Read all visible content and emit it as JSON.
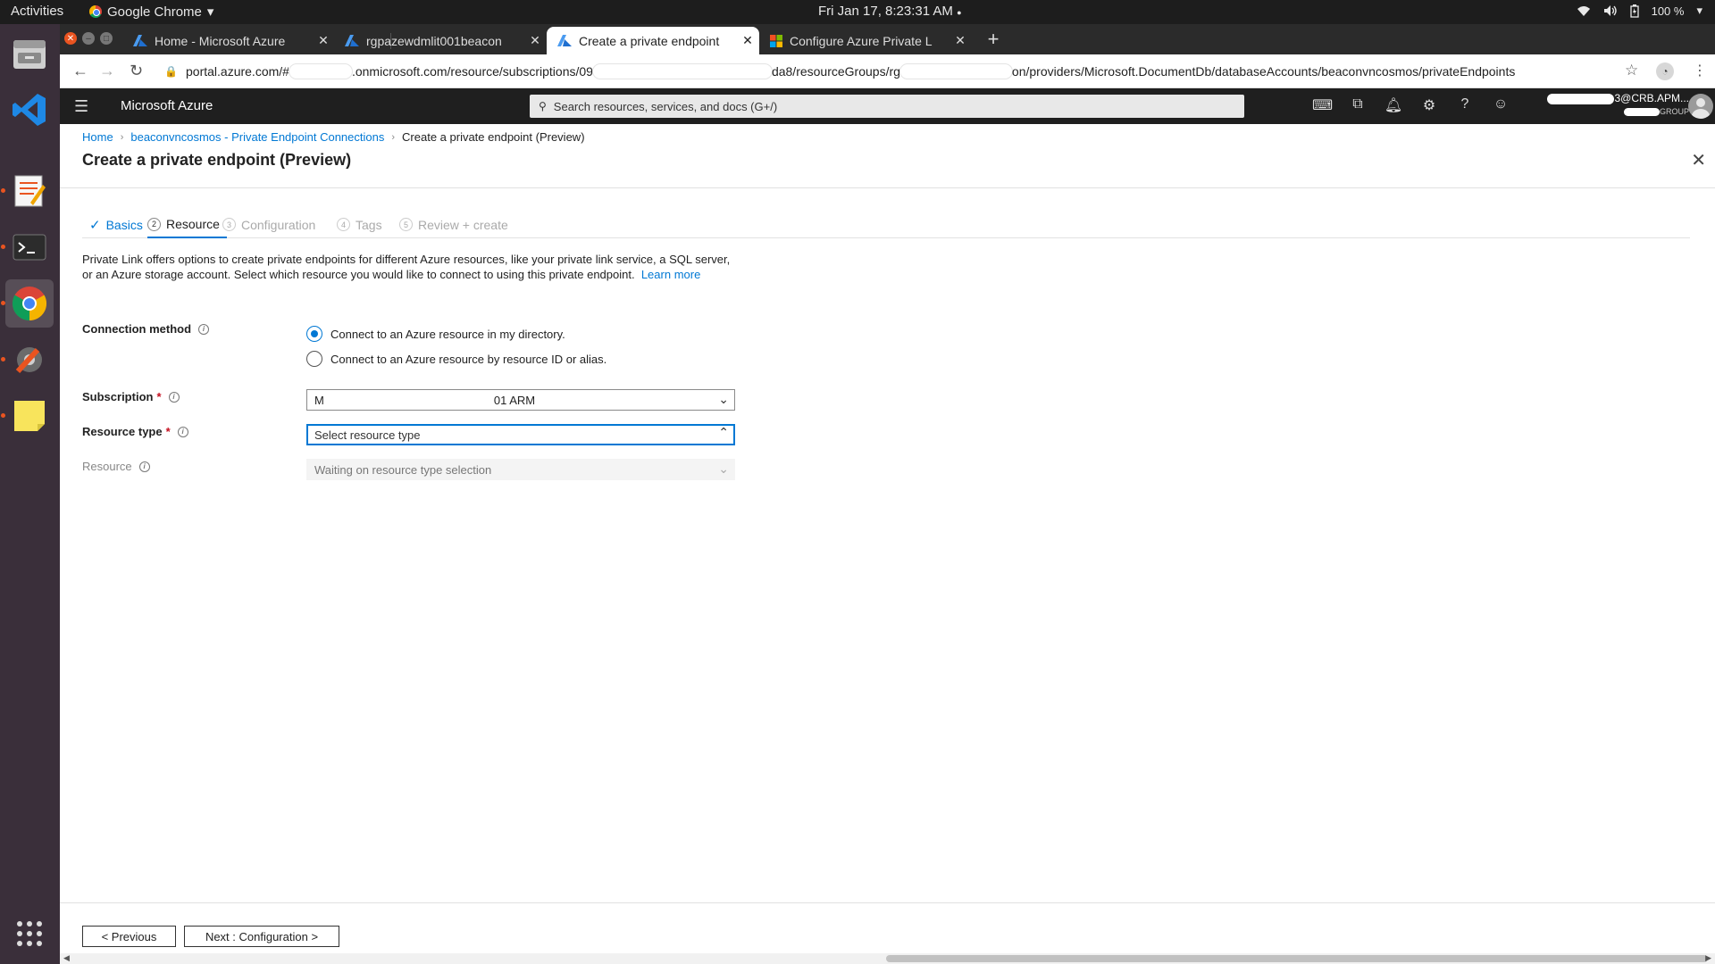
{
  "os": {
    "activities": "Activities",
    "app_name": "Google Chrome",
    "app_menu_caret": "▾",
    "clock": "Fri Jan 17,  8:23:31 AM",
    "clock_dot": "●",
    "battery": "100 %"
  },
  "browser": {
    "tabs": [
      {
        "title": "Home - Microsoft Azure",
        "icon": "azure-icon",
        "active": false
      },
      {
        "title": "rgpazewdmlit001beacon",
        "icon": "azure-icon",
        "active": false
      },
      {
        "title": "Create a private endpoint",
        "icon": "azure-icon",
        "active": true
      },
      {
        "title": "Configure Azure Private L",
        "icon": "microsoft-icon",
        "active": false
      }
    ],
    "url_parts": [
      "portal.azure.com/#",
      ".onmicrosoft.com/resource/subscriptions/09",
      "da8/resourceGroups/rg",
      "on/providers/Microsoft.DocumentDb/databaseAccounts/beaconvncosmos/privateEndpoints"
    ]
  },
  "azure": {
    "brand": "Microsoft Azure",
    "search_placeholder": "Search resources, services, and docs (G+/)",
    "account_name": "3@CRB.APM...",
    "account_dir": "GROUP",
    "breadcrumb": [
      {
        "label": "Home",
        "link": true
      },
      {
        "label": "beaconvncosmos - Private Endpoint Connections",
        "link": true
      },
      {
        "label": "Create a private endpoint (Preview)",
        "link": false
      }
    ],
    "page_title": "Create a private endpoint (Preview)",
    "steps": [
      {
        "num": "✓",
        "label": "Basics",
        "state": "done"
      },
      {
        "num": "2",
        "label": "Resource",
        "state": "current"
      },
      {
        "num": "3",
        "label": "Configuration",
        "state": "future"
      },
      {
        "num": "4",
        "label": "Tags",
        "state": "future"
      },
      {
        "num": "5",
        "label": "Review + create",
        "state": "future"
      }
    ],
    "intro_text": "Private Link offers options to create private endpoints for different Azure resources, like your private link service, a SQL server, or an Azure storage account. Select which resource you would like to connect to using this private endpoint.",
    "learn_more": "Learn more",
    "form": {
      "connection_method_label": "Connection method",
      "radio_options": [
        {
          "label": "Connect to an Azure resource in my directory.",
          "selected": true
        },
        {
          "label": "Connect to an Azure resource by resource ID or alias.",
          "selected": false
        }
      ],
      "subscription_label": "Subscription",
      "subscription_value_start": "M",
      "subscription_value_end": "01 ARM",
      "resource_type_label": "Resource type",
      "resource_type_placeholder": "Select resource type",
      "resource_label": "Resource",
      "resource_placeholder": "Waiting on resource type selection",
      "required_mark": "*"
    },
    "footer": {
      "previous": "< Previous",
      "next": "Next : Configuration >"
    }
  }
}
